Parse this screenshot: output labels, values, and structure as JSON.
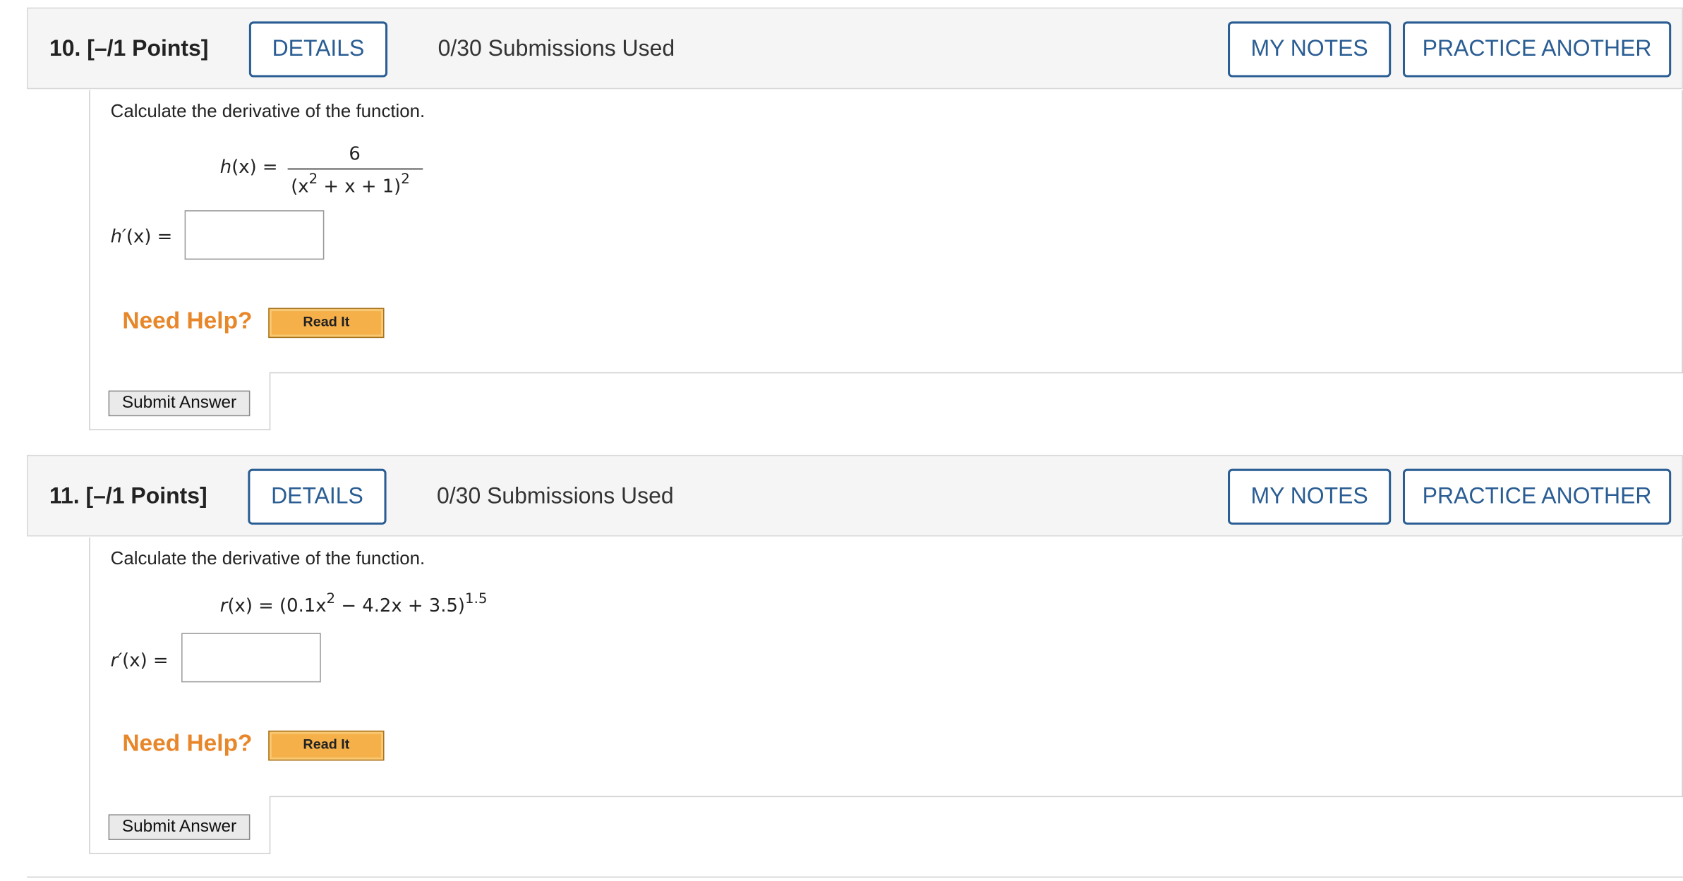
{
  "questions": [
    {
      "number_label": "10.  [–/1 Points]",
      "details_label": "DETAILS",
      "submissions": "0/30 Submissions Used",
      "my_notes_label": "MY NOTES",
      "practice_label": "PRACTICE ANOTHER",
      "prompt": "Calculate the derivative of the function.",
      "func_name": "h",
      "func_lhs": "(x) =",
      "numerator": "6",
      "denominator_a": "(x",
      "denominator_exp": "2",
      "denominator_b": " + x + 1)",
      "denominator_outer_exp": "2",
      "answer_label_name": "h′",
      "answer_label_rest": "(x) =",
      "need_help": "Need Help?",
      "read_it": "Read It",
      "submit": "Submit Answer"
    },
    {
      "number_label": "11.  [–/1 Points]",
      "details_label": "DETAILS",
      "submissions": "0/30 Submissions Used",
      "my_notes_label": "MY NOTES",
      "practice_label": "PRACTICE ANOTHER",
      "prompt": "Calculate the derivative of the function.",
      "func_name": "r",
      "func_lhs": "(x) = (0.1x",
      "func_exp1": "2",
      "func_mid": " − 4.2x + 3.5)",
      "func_exp2": "1.5",
      "answer_label_name": "r′",
      "answer_label_rest": "(x) =",
      "need_help": "Need Help?",
      "read_it": "Read It",
      "submit": "Submit Answer"
    }
  ]
}
